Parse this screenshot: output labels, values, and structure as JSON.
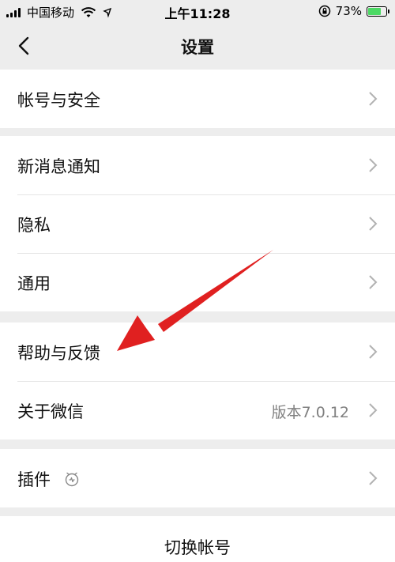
{
  "status_bar": {
    "carrier": "中国移动",
    "time": "上午11:28",
    "battery_percent": "73%",
    "battery_level": 0.73,
    "icons": [
      "signal-icon",
      "wifi-icon",
      "location-icon",
      "orientation-lock-icon",
      "battery-icon"
    ]
  },
  "nav": {
    "title": "设置",
    "back_icon": "chevron-left-icon"
  },
  "groups": [
    {
      "items": [
        {
          "label": "帐号与安全"
        }
      ]
    },
    {
      "items": [
        {
          "label": "新消息通知"
        },
        {
          "label": "隐私"
        },
        {
          "label": "通用"
        }
      ]
    },
    {
      "items": [
        {
          "label": "帮助与反馈"
        },
        {
          "label": "关于微信",
          "value": "版本7.0.12"
        }
      ]
    },
    {
      "items": [
        {
          "label": "插件",
          "icon": "plugin-icon"
        }
      ]
    }
  ],
  "switch_account": {
    "label": "切换帐号"
  },
  "annotation": {
    "color": "#e02020",
    "icon": "red-arrow-annotation"
  },
  "colors": {
    "background": "#ededed",
    "row": "#ffffff",
    "secondary_text": "#808080",
    "battery": "#4cd964"
  }
}
